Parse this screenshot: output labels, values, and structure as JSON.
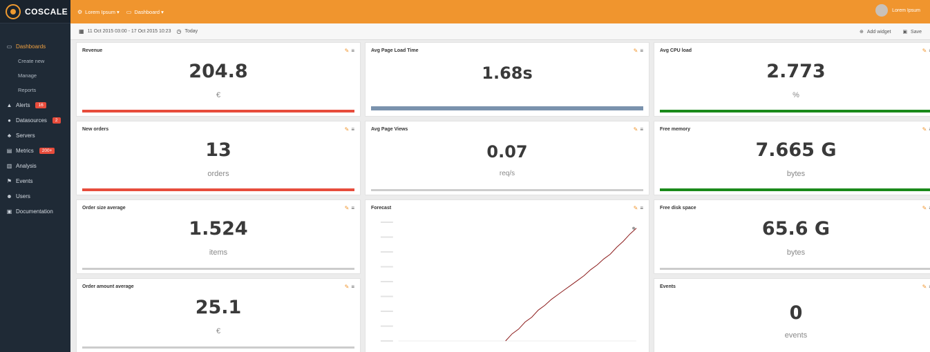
{
  "app": {
    "logo_text": "COSCALE"
  },
  "sidebar": {
    "items": [
      {
        "label": "Dashboards",
        "icon": "monitor-icon",
        "active": true
      },
      {
        "label": "Create new",
        "sub": true
      },
      {
        "label": "Manage",
        "sub": true
      },
      {
        "label": "Reports",
        "sub": true
      },
      {
        "label": "Alerts",
        "icon": "warning-icon",
        "badge": "16"
      },
      {
        "label": "Datasources",
        "icon": "plug-icon",
        "badge": "2"
      },
      {
        "label": "Servers",
        "icon": "sitemap-icon"
      },
      {
        "label": "Metrics",
        "icon": "list-icon",
        "badge": "200+"
      },
      {
        "label": "Analysis",
        "icon": "bar-chart-icon"
      },
      {
        "label": "Events",
        "icon": "flag-icon"
      },
      {
        "label": "Users",
        "icon": "users-icon"
      },
      {
        "label": "Documentation",
        "icon": "book-icon"
      }
    ]
  },
  "topbar": {
    "crumb1": "Lorem Ipsum ▾",
    "crumb2": "Dashboard ▾",
    "user": "Lorem Ipsum"
  },
  "subbar": {
    "date_range": "11 Oct 2015 03:00 - 17 Oct 2015 10:23",
    "period": "Today",
    "add_widget": "Add widget",
    "save": "Save"
  },
  "widgets": [
    {
      "title": "Revenue",
      "value": "204.8",
      "unit": "€",
      "bar_color": "#e74c3c"
    },
    {
      "title": "Avg Page Load Time",
      "value": "1.68s",
      "unit": "",
      "bar_color": "#7a92ad"
    },
    {
      "title": "Avg CPU load",
      "value": "2.773",
      "unit": "%",
      "bar_color": "#1a8a1a"
    },
    {
      "title": "New orders",
      "value": "13",
      "unit": "orders",
      "bar_color": "#e74c3c"
    },
    {
      "title": "Avg Page Views",
      "value": "0.07",
      "unit": "req/s",
      "bar_color": "#cccccc"
    },
    {
      "title": "Free memory",
      "value": "7.665 G",
      "unit": "bytes",
      "bar_color": "#1a8a1a"
    },
    {
      "title": "Order size average",
      "value": "1.524",
      "unit": "items",
      "bar_color": "#cccccc"
    },
    {
      "title": "Forecast",
      "value": "",
      "unit": "",
      "bar_color": ""
    },
    {
      "title": "Free disk space",
      "value": "65.6 G",
      "unit": "bytes",
      "bar_color": "#cccccc"
    },
    {
      "title": "Order amount average",
      "value": "25.1",
      "unit": "€",
      "bar_color": "#cccccc"
    },
    {
      "title": "Events",
      "value": "0",
      "unit": "events",
      "bar_color": ""
    }
  ],
  "chart_data": {
    "type": "line",
    "title": "Forecast",
    "x": [
      0,
      1,
      2,
      3,
      4,
      5,
      6,
      7,
      8,
      9,
      10,
      11,
      12,
      13,
      14,
      15,
      16,
      17,
      18,
      19,
      20
    ],
    "series": [
      {
        "values": [
          0.0,
          0.06,
          0.1,
          0.16,
          0.2,
          0.26,
          0.3,
          0.35,
          0.39,
          0.43,
          0.47,
          0.51,
          0.55,
          0.6,
          0.64,
          0.69,
          0.73,
          0.79,
          0.84,
          0.9,
          0.95
        ]
      }
    ],
    "ylim": [
      0,
      1
    ],
    "grid": false,
    "line_color": "#8b1a1a"
  }
}
